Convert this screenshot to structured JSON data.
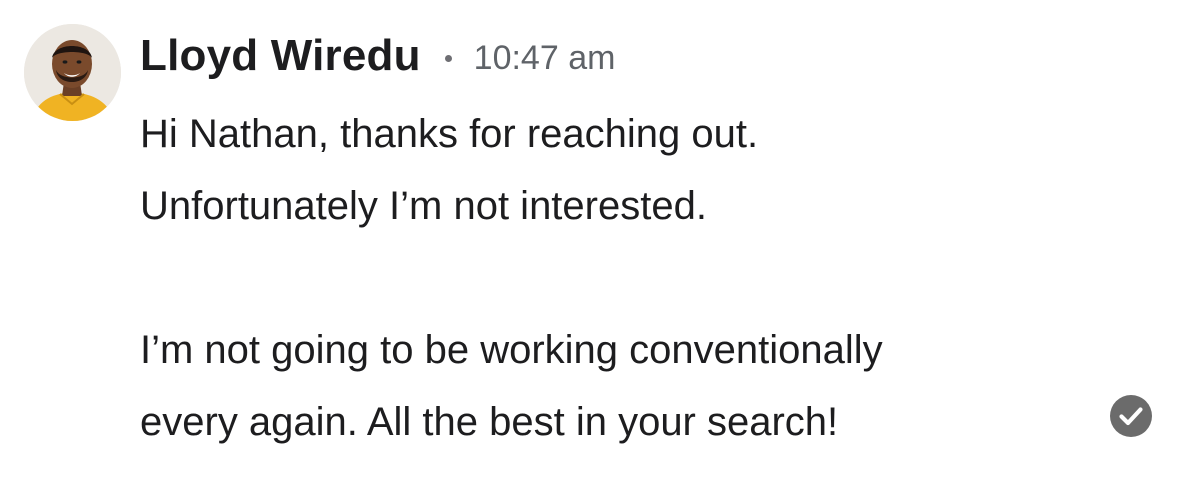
{
  "message": {
    "sender_name": "Lloyd Wiredu",
    "timestamp": "10:47 am",
    "lines": [
      "Hi Nathan, thanks for reaching out.",
      "Unfortunately I’m not interested.",
      "",
      "I’m not going to be working conventionally",
      "every again. All the best in your search!"
    ],
    "status_icon": "check-circle-icon"
  },
  "colors": {
    "name_text": "#1d1d1f",
    "timestamp_text": "#5f6368",
    "body_text": "#1d1d1f",
    "read_receipt": "#6b6b6b",
    "avatar_shirt": "#f0b323"
  }
}
